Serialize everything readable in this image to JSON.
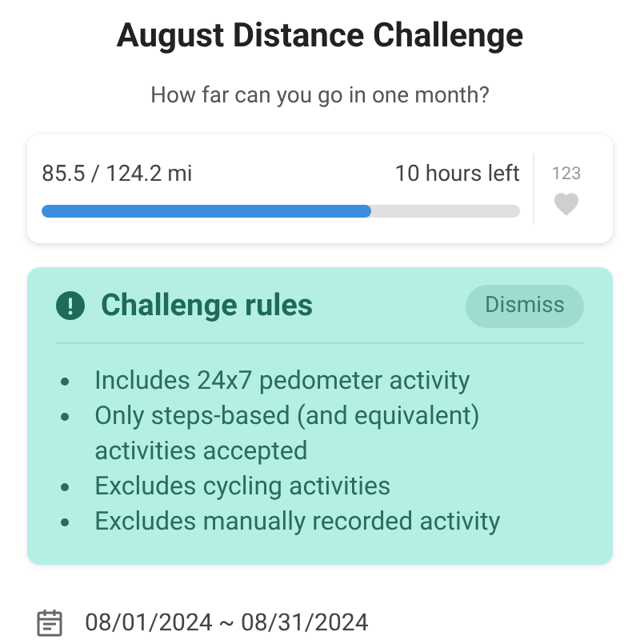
{
  "title": "August Distance Challenge",
  "subtitle": "How far can you go in one month?",
  "progress": {
    "distance": "85.5 / 124.2 mi",
    "time_left": "10 hours left",
    "level": 0.69,
    "likes": "123",
    "liked": false
  },
  "rules": {
    "title": "Challenge rules",
    "dismiss": "Dismiss",
    "items": [
      "Includes 24x7 pedometer activity",
      "Only steps-based (and equivalent) activities accepted",
      "Excludes cycling activities",
      "Excludes manually recorded activity"
    ]
  },
  "dates": "08/01/2024 ~ 08/31/2024"
}
